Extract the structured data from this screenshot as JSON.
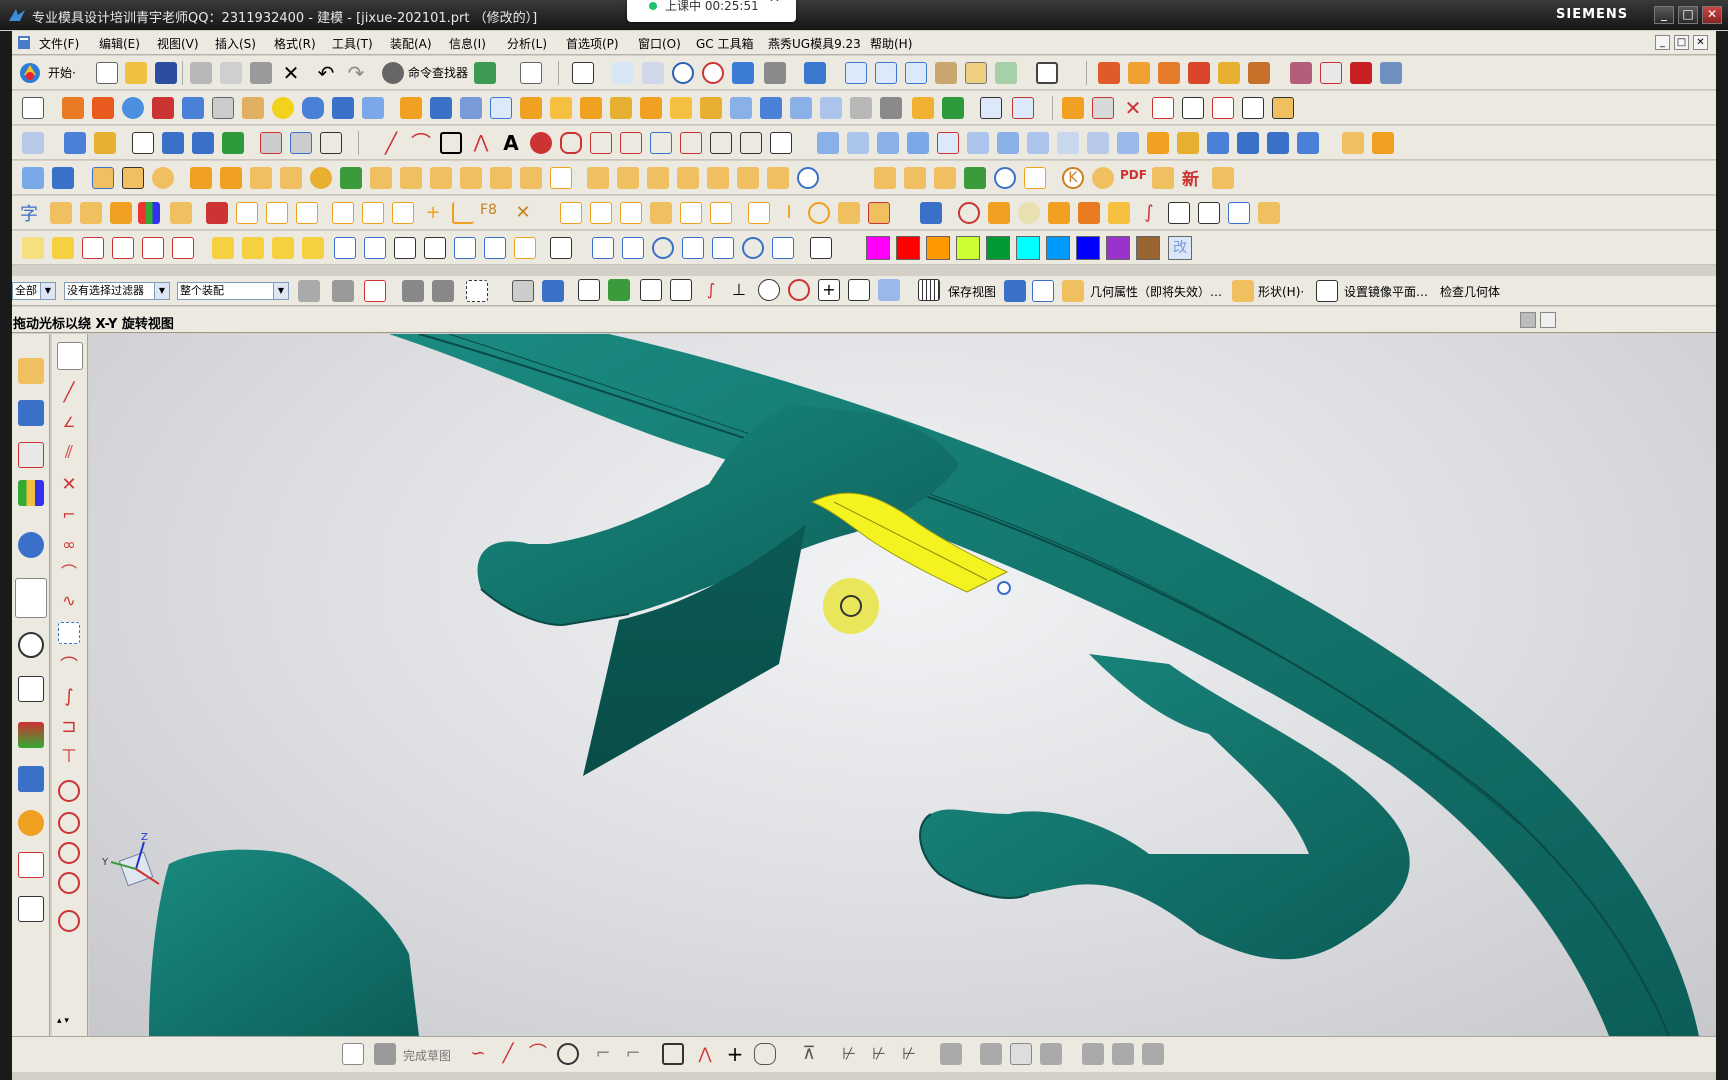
{
  "window": {
    "title": "专业模具设计培训青宇老师QQ：2311932400 - 建模 - [jixue-202101.prt （修改的）]",
    "brand": "SIEMENS",
    "controls": [
      "_",
      "□",
      "✕"
    ]
  },
  "recording": {
    "status": "上课中 00:25:51",
    "chevron": "^"
  },
  "menu": {
    "items": [
      "文件(F)",
      "编辑(E)",
      "视图(V)",
      "插入(S)",
      "格式(R)",
      "工具(T)",
      "装配(A)",
      "信息(I)",
      "分析(L)",
      "首选项(P)",
      "窗口(O)",
      "GC 工具箱",
      "燕秀UG模具9.23",
      "帮助(H)"
    ],
    "doc_controls": [
      "_",
      "□",
      "✕"
    ]
  },
  "standard_toolbar": {
    "start_label": "开始·",
    "command_finder": "命令查找器"
  },
  "colors": {
    "swatches": [
      "#ff00ff",
      "#ff0000",
      "#ff9900",
      "#ccff33",
      "#009933",
      "#00ffff",
      "#0099ff",
      "#0000ff",
      "#9933cc",
      "#996633"
    ],
    "swatch_end_label": "改",
    "title_bg": "#1c1c1c",
    "toolbar_bg": "#ece9e1",
    "model_teal": "#0f6e66",
    "highlight_face": "#f4f320"
  },
  "extra_toolbar": {
    "pdf_label": "PDF",
    "new_label": "新",
    "char_label": "字",
    "f8_label": "F8"
  },
  "selection_bar": {
    "filter_scope": "全部",
    "type_filter": "没有选择过滤器",
    "assembly_scope": "整个装配",
    "save_view": "保存视图",
    "geom_props": "几何属性（即将失效）…",
    "shape": "形状(H)·",
    "mirror_plane": "设置镜像平面…",
    "check_geometry": "检查几何体"
  },
  "cue_line": {
    "text": "拖动光标以绕 X-Y 旋转视图"
  },
  "bottom_bar": {
    "finish_sketch": "完成草图"
  },
  "triad": {
    "x": "X",
    "y": "Y",
    "z": "Z"
  },
  "resource_bar_icons": [
    "assembly-navigator-icon",
    "constraint-navigator-icon",
    "part-navigator-icon",
    "reuse-library-icon",
    "hd3d-tools-icon",
    "web-browser-icon",
    "history-icon",
    "process-studio-icon",
    "visualization-icon",
    "manufacturing-wizards-icon",
    "roles-icon",
    "system-scenes-icon",
    "drawing-icon"
  ]
}
